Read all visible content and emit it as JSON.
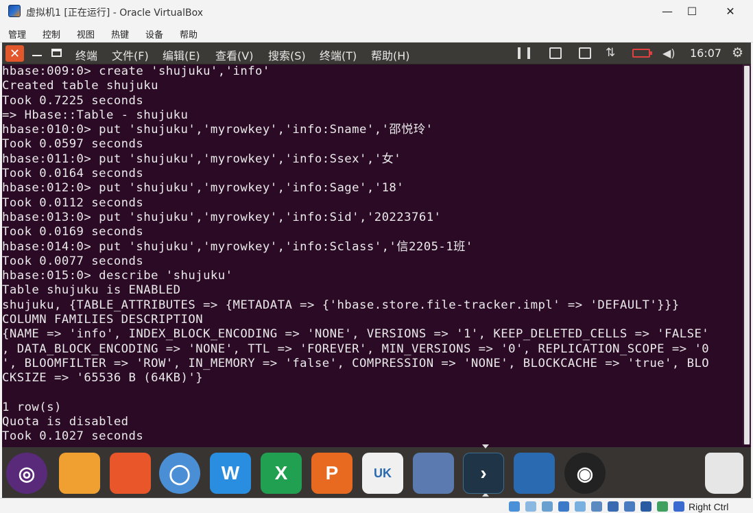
{
  "window": {
    "title": "虚拟机1 [正在运行] - Oracle VirtualBox",
    "minimize": "—",
    "maximize": "☐",
    "close": "✕"
  },
  "vbox_menu": [
    "管理",
    "控制",
    "视图",
    "热键",
    "设备",
    "帮助"
  ],
  "terminal": {
    "app_label": "终端",
    "menu": [
      "文件(F)",
      "编辑(E)",
      "查看(V)",
      "搜索(S)",
      "终端(T)",
      "帮助(H)"
    ],
    "clock": "16:07",
    "lines": [
      "hbase:009:0> create 'shujuku','info'",
      "Created table shujuku",
      "Took 0.7225 seconds",
      "=> Hbase::Table - shujuku",
      "hbase:010:0> put 'shujuku','myrowkey','info:Sname','邵悦玲'",
      "Took 0.0597 seconds",
      "hbase:011:0> put 'shujuku','myrowkey','info:Ssex','女'",
      "Took 0.0164 seconds",
      "hbase:012:0> put 'shujuku','myrowkey','info:Sage','18'",
      "Took 0.0112 seconds",
      "hbase:013:0> put 'shujuku','myrowkey','info:Sid','20223761'",
      "Took 0.0169 seconds",
      "hbase:014:0> put 'shujuku','myrowkey','info:Sclass','信2205-1班'",
      "Took 0.0077 seconds",
      "hbase:015:0> describe 'shujuku'",
      "Table shujuku is ENABLED",
      "shujuku, {TABLE_ATTRIBUTES => {METADATA => {'hbase.store.file-tracker.impl' => 'DEFAULT'}}}",
      "COLUMN FAMILIES DESCRIPTION",
      "{NAME => 'info', INDEX_BLOCK_ENCODING => 'NONE', VERSIONS => '1', KEEP_DELETED_CELLS => 'FALSE'",
      ", DATA_BLOCK_ENCODING => 'NONE', TTL => 'FOREVER', MIN_VERSIONS => '0', REPLICATION_SCOPE => '0",
      "', BLOOMFILTER => 'ROW', IN_MEMORY => 'false', COMPRESSION => 'NONE', BLOCKCACHE => 'true', BLO",
      "CKSIZE => '65536 B (64KB)'}",
      "",
      "1 row(s)",
      "Quota is disabled",
      "Took 0.1027 seconds"
    ]
  },
  "dock": {
    "items": [
      {
        "name": "ubuntu-launcher",
        "color": "#5a2a7a",
        "glyph": "◎"
      },
      {
        "name": "files",
        "color": "#f0a030",
        "glyph": ""
      },
      {
        "name": "firefox",
        "color": "#e8562a",
        "glyph": ""
      },
      {
        "name": "chromium",
        "color": "#4a8fd6",
        "glyph": "◯"
      },
      {
        "name": "writer",
        "color": "#2a8ee0",
        "glyph": "W"
      },
      {
        "name": "calc",
        "color": "#20a050",
        "glyph": "X"
      },
      {
        "name": "impress",
        "color": "#e86a20",
        "glyph": "P"
      },
      {
        "name": "ubuntu-kylin",
        "color": "#f0f0f0",
        "glyph": "UK"
      },
      {
        "name": "software-center",
        "color": "#5a7ab0",
        "glyph": ""
      },
      {
        "name": "terminal",
        "color": "#1f3547",
        "glyph": "›"
      },
      {
        "name": "workspaces",
        "color": "#2a6ab0",
        "glyph": ""
      },
      {
        "name": "dvd",
        "color": "#222222",
        "glyph": "◉"
      }
    ],
    "trash_label": "trash-icon"
  },
  "host_bar": {
    "key_label": "Right Ctrl"
  }
}
